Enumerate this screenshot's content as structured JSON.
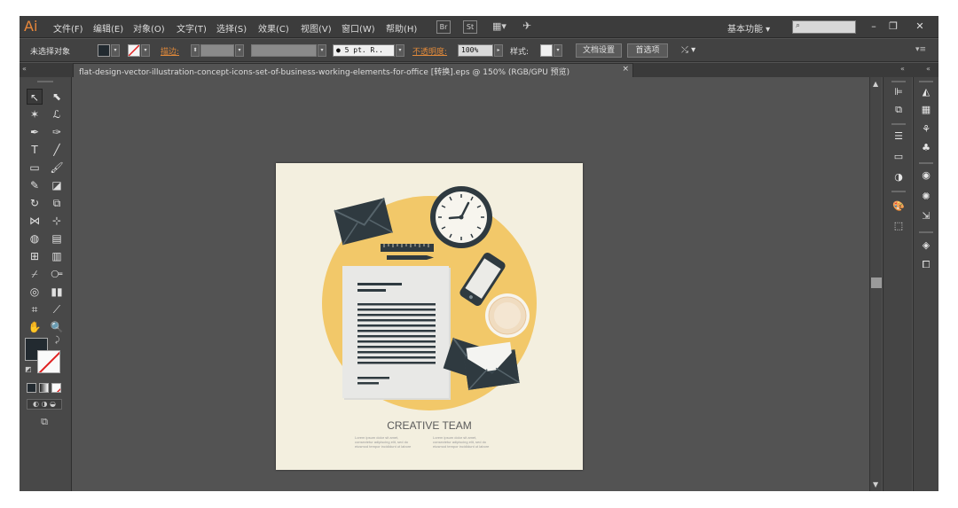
{
  "app": {
    "logo": "Ai",
    "menus": [
      "文件(F)",
      "编辑(E)",
      "对象(O)",
      "文字(T)",
      "选择(S)",
      "效果(C)",
      "视图(V)",
      "窗口(W)",
      "帮助(H)"
    ],
    "bridge_icon": "Br",
    "stock_icon": "St",
    "workspace": "基本功能",
    "window_buttons": [
      "–",
      "❐",
      "✕"
    ]
  },
  "control_bar": {
    "selection": "未选择对象",
    "stroke_label": "描边:",
    "point_value": "● 5 pt. R..",
    "opacity_label": "不透明度:",
    "opacity_value": "100%",
    "style_label": "样式:",
    "doc_setup_button": "文档设置",
    "prefs_button": "首选项"
  },
  "document": {
    "tab_title": "flat-design-vector-illustration-concept-icons-set-of-business-working-elements-for-office [转换].eps @ 150% (RGB/GPU 预览)",
    "close": "×"
  },
  "artwork": {
    "heading": "CREATIVE TEAM",
    "blurb_left": [
      "Lorem ipsum dolor sit amet,",
      "consectetur adipiscing elit, sed do",
      "eiusmod tempor incididunt ut labore"
    ],
    "blurb_right": [
      "Lorem ipsum dolor sit amet,",
      "consectetur adipiscing elit, sed do",
      "eiusmod tempor incididunt ut labore"
    ],
    "colors": {
      "circle": "#f2c869",
      "dark": "#2f3a40",
      "paper": "#e8e8e6",
      "background": "#f3efdf"
    }
  },
  "colors": {
    "accent": "#e8873a",
    "ui_dark": "#3c3c3c",
    "canvas": "#535353"
  }
}
